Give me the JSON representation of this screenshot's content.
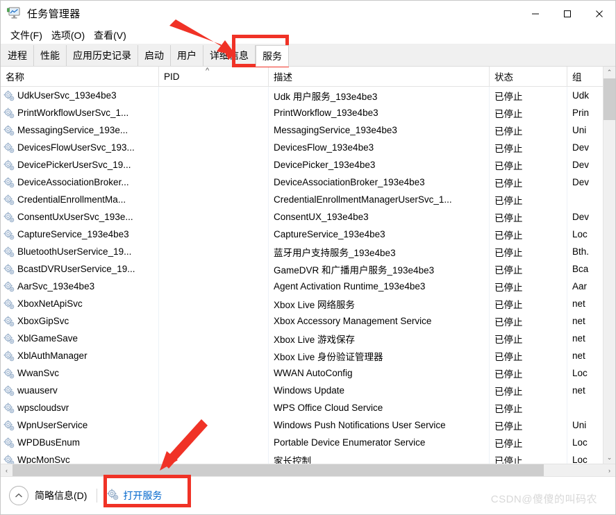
{
  "window": {
    "title": "任务管理器",
    "app_icon": "task-manager-monitor-icon",
    "controls": {
      "minimize": "—",
      "maximize": "□",
      "close": "✕"
    }
  },
  "menu": {
    "items": [
      {
        "label": "文件(F)"
      },
      {
        "label": "选项(O)"
      },
      {
        "label": "查看(V)"
      }
    ]
  },
  "tabs": {
    "items": [
      {
        "label": "进程",
        "active": false
      },
      {
        "label": "性能",
        "active": false
      },
      {
        "label": "应用历史记录",
        "active": false
      },
      {
        "label": "启动",
        "active": false
      },
      {
        "label": "用户",
        "active": false
      },
      {
        "label": "详细信息",
        "active": false
      },
      {
        "label": "服务",
        "active": true
      }
    ]
  },
  "table": {
    "columns": [
      {
        "label": "名称"
      },
      {
        "label": "PID"
      },
      {
        "label": "描述"
      },
      {
        "label": "状态"
      },
      {
        "label": "组"
      }
    ],
    "sort_indicator": "^",
    "rows": [
      {
        "name": "UdkUserSvc_193e4be3",
        "pid": "",
        "desc": "Udk 用户服务_193e4be3",
        "status": "已停止",
        "group": "Udk"
      },
      {
        "name": "PrintWorkflowUserSvc_1...",
        "pid": "",
        "desc": "PrintWorkflow_193e4be3",
        "status": "已停止",
        "group": "Prin"
      },
      {
        "name": "MessagingService_193e...",
        "pid": "",
        "desc": "MessagingService_193e4be3",
        "status": "已停止",
        "group": "Uni"
      },
      {
        "name": "DevicesFlowUserSvc_193...",
        "pid": "",
        "desc": "DevicesFlow_193e4be3",
        "status": "已停止",
        "group": "Dev"
      },
      {
        "name": "DevicePickerUserSvc_19...",
        "pid": "",
        "desc": "DevicePicker_193e4be3",
        "status": "已停止",
        "group": "Dev"
      },
      {
        "name": "DeviceAssociationBroker...",
        "pid": "",
        "desc": "DeviceAssociationBroker_193e4be3",
        "status": "已停止",
        "group": "Dev"
      },
      {
        "name": "CredentialEnrollmentMa...",
        "pid": "",
        "desc": "CredentialEnrollmentManagerUserSvc_1...",
        "status": "已停止",
        "group": ""
      },
      {
        "name": "ConsentUxUserSvc_193e...",
        "pid": "",
        "desc": "ConsentUX_193e4be3",
        "status": "已停止",
        "group": "Dev"
      },
      {
        "name": "CaptureService_193e4be3",
        "pid": "",
        "desc": "CaptureService_193e4be3",
        "status": "已停止",
        "group": "Loc"
      },
      {
        "name": "BluetoothUserService_19...",
        "pid": "",
        "desc": "蓝牙用户支持服务_193e4be3",
        "status": "已停止",
        "group": "Bth."
      },
      {
        "name": "BcastDVRUserService_19...",
        "pid": "",
        "desc": "GameDVR 和广播用户服务_193e4be3",
        "status": "已停止",
        "group": "Bca"
      },
      {
        "name": "AarSvc_193e4be3",
        "pid": "",
        "desc": "Agent Activation Runtime_193e4be3",
        "status": "已停止",
        "group": "Aar"
      },
      {
        "name": "XboxNetApiSvc",
        "pid": "",
        "desc": "Xbox Live 网络服务",
        "status": "已停止",
        "group": "net"
      },
      {
        "name": "XboxGipSvc",
        "pid": "",
        "desc": "Xbox Accessory Management Service",
        "status": "已停止",
        "group": "net"
      },
      {
        "name": "XblGameSave",
        "pid": "",
        "desc": "Xbox Live 游戏保存",
        "status": "已停止",
        "group": "net"
      },
      {
        "name": "XblAuthManager",
        "pid": "",
        "desc": "Xbox Live 身份验证管理器",
        "status": "已停止",
        "group": "net"
      },
      {
        "name": "WwanSvc",
        "pid": "",
        "desc": "WWAN AutoConfig",
        "status": "已停止",
        "group": "Loc"
      },
      {
        "name": "wuauserv",
        "pid": "",
        "desc": "Windows Update",
        "status": "已停止",
        "group": "net"
      },
      {
        "name": "wpscloudsvr",
        "pid": "",
        "desc": "WPS Office Cloud Service",
        "status": "已停止",
        "group": ""
      },
      {
        "name": "WpnUserService",
        "pid": "",
        "desc": "Windows Push Notifications User Service",
        "status": "已停止",
        "group": "Uni"
      },
      {
        "name": "WPDBusEnum",
        "pid": "",
        "desc": "Portable Device Enumerator Service",
        "status": "已停止",
        "group": "Loc"
      },
      {
        "name": "WpcMonSvc",
        "pid": "",
        "desc": "家长控制",
        "status": "已停止",
        "group": "Loc"
      }
    ]
  },
  "scrollbars": {
    "vertical_up": "⌃",
    "vertical_down": "⌄",
    "horizontal_left": "‹",
    "horizontal_right": "›"
  },
  "statusbar": {
    "collapse_icon": "⌃",
    "brief_label": "简略信息(D)",
    "open_services_label": "打开服务",
    "open_services_icon": "services-gear-icon"
  },
  "watermark": {
    "text": "CSDN@傻傻的叫码农"
  },
  "annotations": {
    "arrow_to_tab": "red-arrow-pointing-to-services-tab",
    "arrow_to_open_services": "red-arrow-pointing-to-open-services-button",
    "box_color": "#f03226"
  }
}
